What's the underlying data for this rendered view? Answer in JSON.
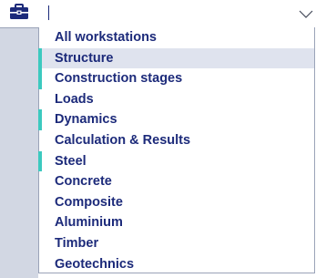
{
  "combo": {
    "value": ""
  },
  "icons": {
    "toolbox": "toolbox-icon",
    "dropdown": "chevron-down-icon"
  },
  "colors": {
    "text": "#1c2a7a",
    "marker": "#3cc9bf",
    "selected_bg": "#dfe3ee",
    "panel": "#d2d7e3"
  },
  "workstations": [
    {
      "label": "All workstations",
      "marked": false,
      "selected": false
    },
    {
      "label": "Structure",
      "marked": true,
      "selected": true
    },
    {
      "label": "Construction stages",
      "marked": true,
      "selected": false
    },
    {
      "label": "Loads",
      "marked": false,
      "selected": false
    },
    {
      "label": "Dynamics",
      "marked": true,
      "selected": false
    },
    {
      "label": "Calculation & Results",
      "marked": false,
      "selected": false
    },
    {
      "label": "Steel",
      "marked": true,
      "selected": false
    },
    {
      "label": "Concrete",
      "marked": false,
      "selected": false
    },
    {
      "label": "Composite",
      "marked": false,
      "selected": false
    },
    {
      "label": "Aluminium",
      "marked": false,
      "selected": false
    },
    {
      "label": "Timber",
      "marked": false,
      "selected": false
    },
    {
      "label": "Geotechnics",
      "marked": false,
      "selected": false
    }
  ]
}
